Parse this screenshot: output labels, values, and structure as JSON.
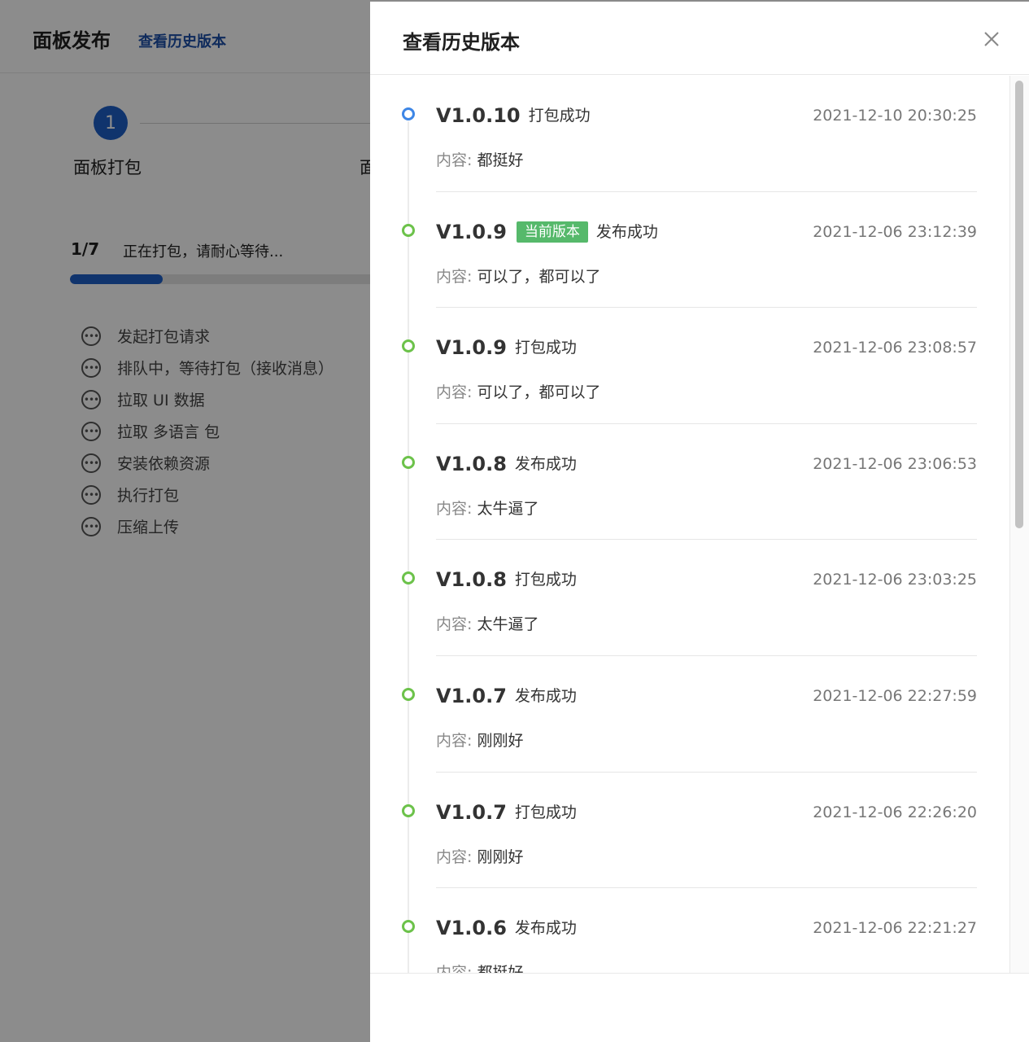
{
  "page": {
    "title": "面板发布",
    "history_link": "查看历史版本",
    "step1": {
      "number": "1",
      "label": "面板打包"
    },
    "step2": {
      "label": "面"
    },
    "progress": {
      "count": "1/7",
      "text": "正在打包，请耐心等待...",
      "fraction": 0.3
    },
    "tasks": [
      {
        "label": "发起打包请求",
        "icon": "pending-dots-icon"
      },
      {
        "label": "排队中，等待打包（接收消息）",
        "icon": "pending-dots-icon"
      },
      {
        "label": "拉取 UI 数据",
        "icon": "pending-dots-icon"
      },
      {
        "label": "拉取 多语言 包",
        "icon": "pending-dots-icon"
      },
      {
        "label": "安装依赖资源",
        "icon": "pending-dots-icon"
      },
      {
        "label": "执行打包",
        "icon": "pending-dots-icon"
      },
      {
        "label": "压缩上传",
        "icon": "pending-dots-icon"
      }
    ]
  },
  "drawer": {
    "title": "查看历史版本",
    "close_icon": "close-icon",
    "content_label": "内容:",
    "versions": [
      {
        "version": "V1.0.10",
        "tag": "",
        "status": "打包成功",
        "time": "2021-12-10 20:30:25",
        "content": "都挺好",
        "dot": "blue"
      },
      {
        "version": "V1.0.9",
        "tag": "当前版本",
        "status": "发布成功",
        "time": "2021-12-06 23:12:39",
        "content": "可以了，都可以了",
        "dot": "green"
      },
      {
        "version": "V1.0.9",
        "tag": "",
        "status": "打包成功",
        "time": "2021-12-06 23:08:57",
        "content": "可以了，都可以了",
        "dot": "green"
      },
      {
        "version": "V1.0.8",
        "tag": "",
        "status": "发布成功",
        "time": "2021-12-06 23:06:53",
        "content": "太牛逼了",
        "dot": "green"
      },
      {
        "version": "V1.0.8",
        "tag": "",
        "status": "打包成功",
        "time": "2021-12-06 23:03:25",
        "content": "太牛逼了",
        "dot": "green"
      },
      {
        "version": "V1.0.7",
        "tag": "",
        "status": "发布成功",
        "time": "2021-12-06 22:27:59",
        "content": "刚刚好",
        "dot": "green"
      },
      {
        "version": "V1.0.7",
        "tag": "",
        "status": "打包成功",
        "time": "2021-12-06 22:26:20",
        "content": "刚刚好",
        "dot": "green"
      },
      {
        "version": "V1.0.6",
        "tag": "",
        "status": "发布成功",
        "time": "2021-12-06 22:21:27",
        "content": "都挺好",
        "dot": "green"
      }
    ]
  },
  "colors": {
    "primary": "#1e5fc7",
    "link": "#1d4fa8",
    "success_dot": "#6cc24a",
    "current_tag": "#56b96b",
    "latest_dot": "#3d86e6"
  }
}
